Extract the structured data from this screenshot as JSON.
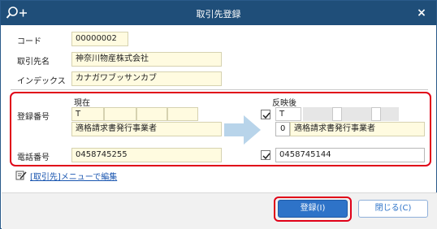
{
  "window": {
    "title": "取引先登録",
    "close_glyph": "×",
    "title_bg": "#1f4e79"
  },
  "form": {
    "code_label": "コード",
    "code_value": "00000002",
    "name_label": "取引先名",
    "name_value": "神奈川物産株式会社",
    "kana_label": "インデックス",
    "kana_value": "カナガワブッサンカブ"
  },
  "compare": {
    "current_header": "現在",
    "after_header": "反映後",
    "reg_label": "登録番号",
    "reg_current_prefix": "T",
    "reg_current_status": "適格請求書発行事業者",
    "reg_after_prefix": "T",
    "reg_after_code": "0",
    "reg_after_status": "適格請求書発行事業者",
    "reg_after_checked": true,
    "phone_label": "電話番号",
    "phone_current": "0458745255",
    "phone_after": "0458745144",
    "phone_after_checked": true,
    "highlight_color": "#e00018"
  },
  "edit_link": {
    "label": "[取引先]メニューで編集"
  },
  "footer": {
    "register_label": "登録(I)",
    "close_label": "閉じる(C)"
  },
  "colors": {
    "accent": "#2e73c8",
    "field_bg": "#fffbe0",
    "arrow": "#b8d4ea"
  }
}
